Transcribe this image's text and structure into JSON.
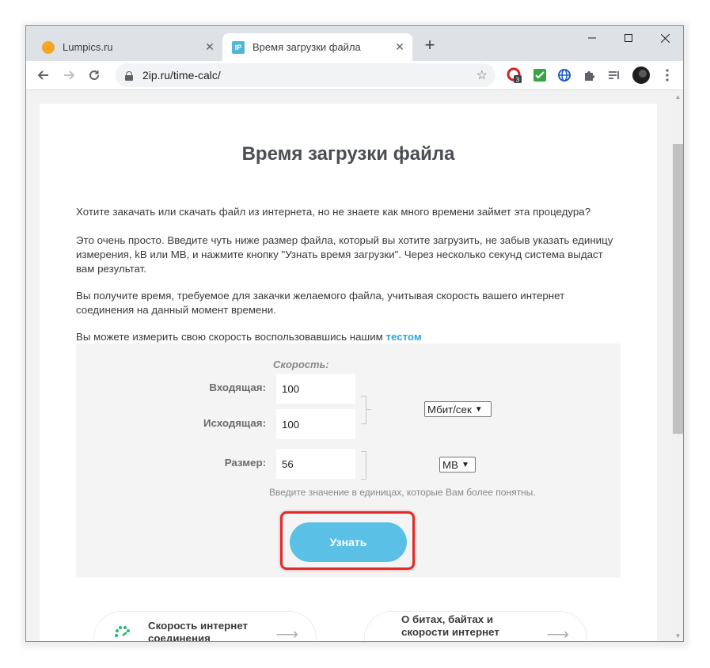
{
  "browser": {
    "tabs": [
      {
        "title": "Lumpics.ru",
        "active": false,
        "favicon": "orange-circle-icon"
      },
      {
        "title": "Время загрузки файла",
        "active": true,
        "favicon": "ip-logo-icon"
      }
    ],
    "url": "2ip.ru/time-calc/",
    "extension_badge": "3"
  },
  "page": {
    "title": "Время загрузки файла",
    "p1": "Хотите закачать или скачать файл из интернета, но не знаете как много времени займет эта процедура?",
    "p2": "Это очень просто. Введите чуть ниже размер файла, который вы хотите загрузить, не забыв указать единицу измерения, kB или MB, и нажмите кнопку \"Узнать время загрузки\". Через несколько секунд система выдаст вам результат.",
    "p3": "Вы получите время, требуемое для закачки желаемого файла, учитывая скорость вашего интернет соединения на данный момент времени.",
    "p4_text": "Вы можете измерить свою скорость воспользовавшись нашим ",
    "p4_link": "тестом"
  },
  "calculator": {
    "speed_label": "Скорость:",
    "incoming_label": "Входящая:",
    "incoming_value": "100",
    "outgoing_label": "Исходящая:",
    "outgoing_value": "100",
    "speed_unit": "Мбит/сек",
    "size_label": "Размер:",
    "size_value": "56",
    "size_unit": "MB",
    "hint": "Введите значение в единицах, которые Вам более понятны.",
    "submit_label": "Узнать"
  },
  "promos": [
    {
      "title_line1": "Скорость интернет",
      "title_line2": "соединения"
    },
    {
      "title_line1": "О битах, байтах и",
      "title_line2": "скорости интернет"
    }
  ],
  "colors": {
    "accent": "#5bc0e6",
    "link": "#2aa8d6",
    "highlight": "#e02b2b"
  }
}
